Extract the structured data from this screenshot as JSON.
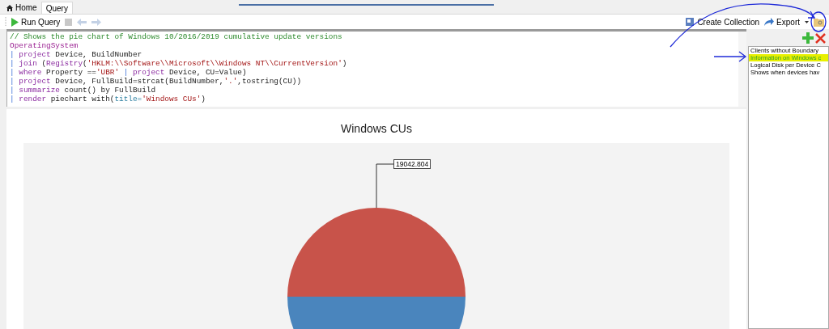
{
  "tabs": [
    {
      "label": "Home",
      "selected": false
    },
    {
      "label": "Query",
      "selected": true
    }
  ],
  "toolbar": {
    "run": "Run Query",
    "nav_disabled": true,
    "create_collection": "Create Collection",
    "export": "Export"
  },
  "editor": {
    "lines": [
      [
        {
          "kind": "comment",
          "text": "// Shows the pie chart of Windows 10/2016/2019 cumulative update versions"
        }
      ],
      [
        {
          "kind": "table",
          "text": "OperatingSystem"
        }
      ],
      [
        {
          "kind": "pipe",
          "text": "| "
        },
        {
          "kind": "keyword",
          "text": "project"
        },
        {
          "kind": "plain",
          "text": " Device, BuildNumber"
        }
      ],
      [
        {
          "kind": "pipe",
          "text": "| "
        },
        {
          "kind": "keyword",
          "text": "join"
        },
        {
          "kind": "plain",
          "text": " ("
        },
        {
          "kind": "keyword",
          "text": "Registry"
        },
        {
          "kind": "plain",
          "text": "("
        },
        {
          "kind": "string",
          "text": "'HKLM:\\\\Software\\\\Microsoft\\\\Windows NT\\\\CurrentVersion'"
        },
        {
          "kind": "plain",
          "text": ")"
        }
      ],
      [
        {
          "kind": "pipe",
          "text": "| "
        },
        {
          "kind": "keyword",
          "text": "where"
        },
        {
          "kind": "plain",
          "text": " Property =="
        },
        {
          "kind": "string",
          "text": "'UBR'"
        },
        {
          "kind": "pipe",
          "text": " | "
        },
        {
          "kind": "keyword",
          "text": "project"
        },
        {
          "kind": "plain",
          "text": " Device, CU=Value)"
        }
      ],
      [
        {
          "kind": "pipe",
          "text": "| "
        },
        {
          "kind": "keyword",
          "text": "project"
        },
        {
          "kind": "plain",
          "text": " Device, FullBuild=strcat(BuildNumber,"
        },
        {
          "kind": "string",
          "text": "'.'"
        },
        {
          "kind": "plain",
          "text": ",tostring(CU))"
        }
      ],
      [
        {
          "kind": "pipe",
          "text": "| "
        },
        {
          "kind": "keyword",
          "text": "summarize"
        },
        {
          "kind": "plain",
          "text": " count() by FullBuild"
        }
      ],
      [
        {
          "kind": "pipe",
          "text": "| "
        },
        {
          "kind": "keyword",
          "text": "render"
        },
        {
          "kind": "plain",
          "text": " piechart with("
        },
        {
          "kind": "param",
          "text": "title="
        },
        {
          "kind": "string",
          "text": "'Windows CUs'"
        },
        {
          "kind": "plain",
          "text": ")"
        }
      ]
    ]
  },
  "saved_queries": [
    {
      "label": "Clients without Boundary",
      "selected": false
    },
    {
      "label": "Information on Windows c",
      "selected": true
    },
    {
      "label": "Logical Disk per Device C",
      "selected": false
    },
    {
      "label": "Shows when devices hav",
      "selected": false
    }
  ],
  "result": {
    "title": "Windows CUs",
    "slice_label": "19042.804",
    "slices": [
      {
        "color": "#c8534a"
      },
      {
        "color": "#4a85bd"
      }
    ]
  }
}
